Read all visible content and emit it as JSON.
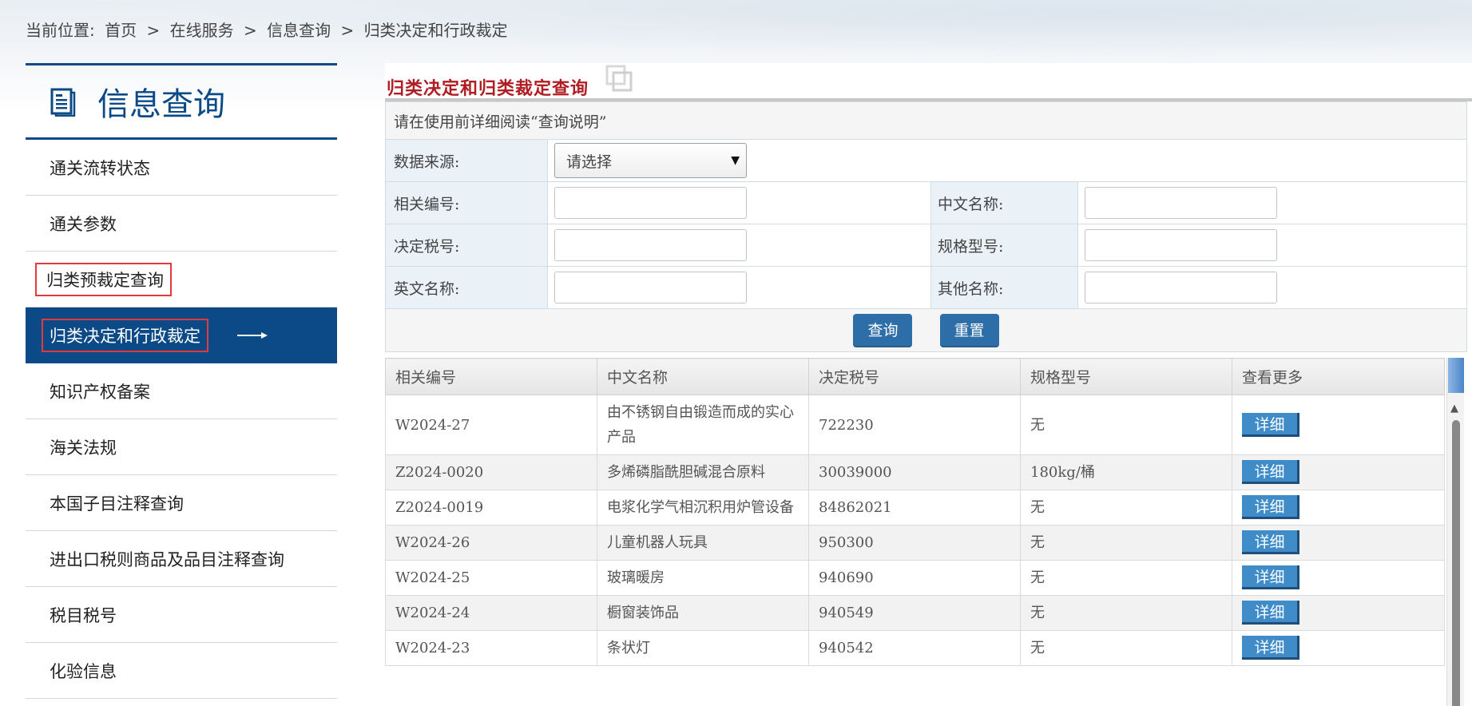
{
  "breadcrumb": {
    "prefix": "当前位置:",
    "items": [
      "首页",
      ">",
      "在线服务",
      ">",
      "信息查询",
      ">",
      "归类决定和行政裁定"
    ]
  },
  "sidebar": {
    "title": "信息查询",
    "items": [
      {
        "label": "通关流转状态"
      },
      {
        "label": "通关参数"
      },
      {
        "label": "归类预裁定查询"
      },
      {
        "label": "归类决定和行政裁定"
      },
      {
        "label": "知识产权备案"
      },
      {
        "label": "海关法规"
      },
      {
        "label": "本国子目注释查询"
      },
      {
        "label": "进出口税则商品及品目注释查询"
      },
      {
        "label": "税目税号"
      },
      {
        "label": "化验信息"
      }
    ]
  },
  "main": {
    "title": "归类决定和归类裁定查询",
    "notice": "请在使用前详细阅读“查询说明”",
    "form": {
      "data_source_label": "数据来源:",
      "data_source_value": "请选择",
      "related_no_label": "相关编号:",
      "chinese_name_label": "中文名称:",
      "tariff_no_label": "决定税号:",
      "spec_label": "规格型号:",
      "english_name_label": "英文名称:",
      "other_name_label": "其他名称:",
      "query_button": "查询",
      "reset_button": "重置"
    },
    "results": {
      "headers": [
        "相关编号",
        "中文名称",
        "决定税号",
        "规格型号",
        "查看更多"
      ],
      "rows": [
        {
          "no": "W2024-27",
          "name": "由不锈钢自由锻造而成的实心产品",
          "tariff": "722230",
          "spec": "无",
          "action": "详细"
        },
        {
          "no": "Z2024-0020",
          "name": "多烯磷脂酰胆碱混合原料",
          "tariff": "30039000",
          "spec": "180kg/桶",
          "action": "详细"
        },
        {
          "no": "Z2024-0019",
          "name": "电浆化学气相沉积用炉管设备",
          "tariff": "84862021",
          "spec": "无",
          "action": "详细"
        },
        {
          "no": "W2024-26",
          "name": "儿童机器人玩具",
          "tariff": "950300",
          "spec": "无",
          "action": "详细"
        },
        {
          "no": "W2024-25",
          "name": "玻璃暖房",
          "tariff": "940690",
          "spec": "无",
          "action": "详细"
        },
        {
          "no": "W2024-24",
          "name": "橱窗装饰品",
          "tariff": "940549",
          "spec": "无",
          "action": "详细"
        },
        {
          "no": "W2024-23",
          "name": "条状灯",
          "tariff": "940542",
          "spec": "无",
          "action": "详细"
        }
      ]
    }
  },
  "colors": {
    "primary": "#0b4a86",
    "title_red": "#b01e24",
    "highlight_box": "#e23b3b",
    "button": "#2d6ea8"
  }
}
